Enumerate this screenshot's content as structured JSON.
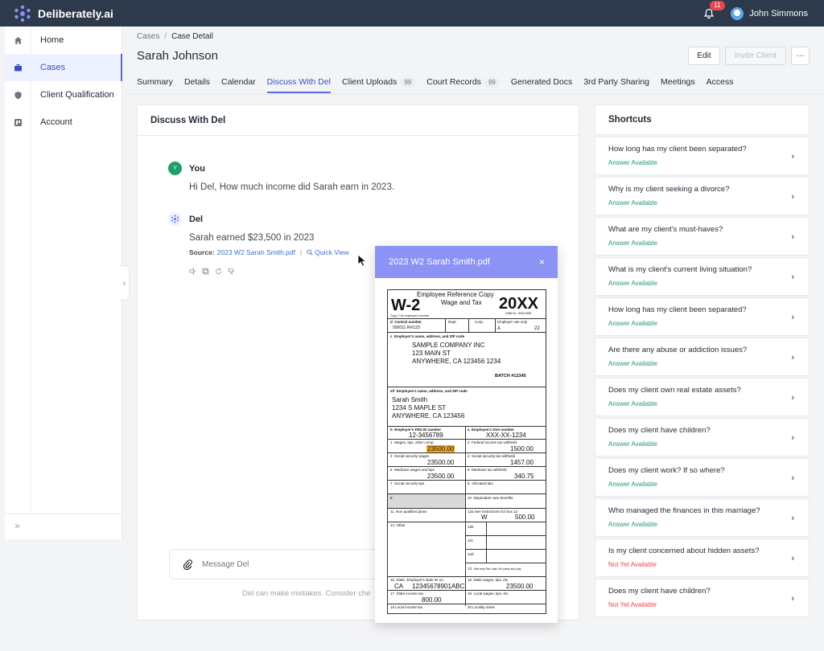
{
  "app": {
    "name": "Deliberately.ai",
    "user": "John Simmons",
    "notifications": "11"
  },
  "sidebar": {
    "items": [
      {
        "label": "Home",
        "icon": "home-icon"
      },
      {
        "label": "Cases",
        "icon": "briefcase-icon"
      },
      {
        "label": "Client Qualification",
        "icon": "shield-icon"
      },
      {
        "label": "Account",
        "icon": "account-icon"
      }
    ],
    "active": "Cases",
    "expand_glyph": "»"
  },
  "breadcrumb": {
    "root": "Cases",
    "separator": "/",
    "current": "Case Detail"
  },
  "page": {
    "title": "Sarah Johnson"
  },
  "header_buttons": {
    "edit": "Edit",
    "invite": "Invite Client",
    "more": "···"
  },
  "tabs": [
    {
      "label": "Summary"
    },
    {
      "label": "Details"
    },
    {
      "label": "Calendar"
    },
    {
      "label": "Discuss With Del",
      "active": true
    },
    {
      "label": "Client Uploads",
      "count": "99"
    },
    {
      "label": "Court Records",
      "count": "99"
    },
    {
      "label": "Generated Docs"
    },
    {
      "label": "3rd Party Sharing"
    },
    {
      "label": "Meetings"
    },
    {
      "label": "Access"
    }
  ],
  "chat": {
    "title": "Discuss With Del",
    "user_msg": {
      "avatar": "Y",
      "author": "You",
      "text": "Hi Del, How much income did Sarah earn in 2023."
    },
    "del_msg": {
      "author": "Del",
      "text": "Sarah earned $23,500 in 2023",
      "source_label": "Source:",
      "source_file": "2023 W2 Sarah Smith.pdf",
      "quick_view": "Quick View"
    },
    "composer_placeholder": "Message Del",
    "disclaimer": "Del can make mistakes. Consider che"
  },
  "shortcuts": {
    "title": "Shortcuts",
    "items": [
      {
        "q": "How long has my client been separated?",
        "status": "Answer Available",
        "ok": true
      },
      {
        "q": "Why is my client seeking a divorce?",
        "status": "Answer Available",
        "ok": true
      },
      {
        "q": "What are my client's must-haves?",
        "status": "Answer Available",
        "ok": true
      },
      {
        "q": "What is my client's current living situation?",
        "status": "Answer Available",
        "ok": true
      },
      {
        "q": "How long has my client been separated?",
        "status": "Answer Available",
        "ok": true
      },
      {
        "q": "Are there any abuse or addiction issues?",
        "status": "Answer Available",
        "ok": true
      },
      {
        "q": "Does my client own real estate assets?",
        "status": "Answer Available",
        "ok": true
      },
      {
        "q": "Does my client have children?",
        "status": "Answer Available",
        "ok": true
      },
      {
        "q": "Does my client work? If so where?",
        "status": "Answer Available",
        "ok": true
      },
      {
        "q": "Who managed the finances in this marriage?",
        "status": "Answer Available",
        "ok": true
      },
      {
        "q": "Is my client concerned about hidden assets?",
        "status": "Not Yet Available",
        "ok": false
      },
      {
        "q": "Does my client have children?",
        "status": "Not Yet Available",
        "ok": false
      }
    ]
  },
  "pdf_modal": {
    "title": "2023 W2 Sarah Smith.pdf",
    "close": "×",
    "w2": {
      "form": "W-2",
      "header_line1": "Employee  Reference  Copy",
      "header_line2": "Wage  and  Tax",
      "year": "20XX",
      "omb": "OMB No. 1545-0008",
      "copy_note": "Copy C for employee's records.",
      "control_label": "Control number",
      "control_value": "000011  R#/123",
      "dept": "Dept.",
      "corp": "Corp.",
      "employer_use": "Employer use only",
      "employer_use_a": "A",
      "employer_use_val": "22",
      "employer_label": "Employer's name, address, and ZIP code",
      "employer_name": "SAMPLE  COMPANY  INC",
      "employer_addr1": "123  MAIN ST",
      "employer_addr2": "ANYWHERE,  CA   123456   1234",
      "batch": "BATCH #12345",
      "employee_label": "Employee's name, address, and ZIP code",
      "employee_name": "Sarah Smith",
      "employee_addr1": "1234  S  MAPLE  ST",
      "employee_addr2": "ANYWHERE,  CA   123456",
      "fed_id_label": "Employer's  FED  ID  number",
      "fed_id": "12-3456789",
      "ssa_label": "Employee's  SSA  number",
      "ssa": "XXX-XX-1234",
      "box1_label": "Wages, tips, other comp.",
      "box1": "23500.00",
      "box2_label": "Federal income tax withheld",
      "box2": "1500.00",
      "box3_label": "Social security wages",
      "box3": "23500.00",
      "box4_label": "Social security tax withheld",
      "box4": "1457.00",
      "box5_label": "Medicare wages and tips",
      "box5": "23500.00",
      "box6_label": "Medicare tax withheld",
      "box6": "340.75",
      "box7_label": "Social security tips",
      "box8_label": "Allocated tips",
      "box9_label": "",
      "box10_label": "Dependent care benefits",
      "box11_label": "Non qualified  plans",
      "box12_label": "See instructions for box 12",
      "box12a_code": "W",
      "box12a": "500.00",
      "box12b": "12b",
      "box12c": "12c",
      "box12d": "12d",
      "box13_labels": "Stat emp  Ret. plan  3rd party sick pay",
      "box14_label": "Other",
      "state_label": "State",
      "state": "CA",
      "state_id_label": "Employer's  state  ID  no.",
      "state_id": "12345678901ABC",
      "box16_label": "State  wages,  tips,  etc.",
      "box16": "23500.00",
      "box17_label": "State  income  tax",
      "box17": "800.00",
      "box18_label": "Local  wages,  tips,  etc.",
      "box19_label": "Local  income  tax",
      "box20_label": "Locality  name"
    }
  }
}
